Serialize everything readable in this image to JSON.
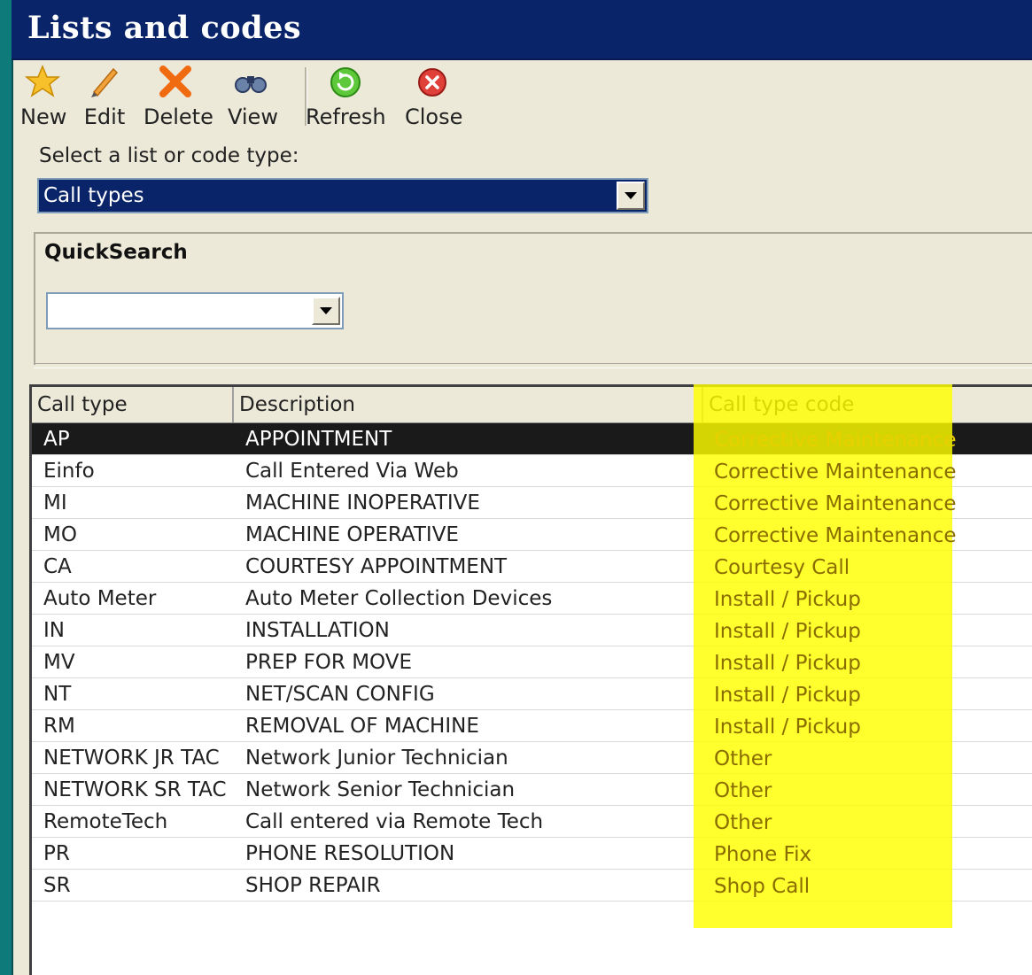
{
  "window": {
    "title": "Lists and codes"
  },
  "toolbar": {
    "new_label": "New",
    "edit_label": "Edit",
    "delete_label": "Delete",
    "view_label": "View",
    "refresh_label": "Refresh",
    "close_label": "Close"
  },
  "selector": {
    "label": "Select a list or code type:",
    "value": "Call types"
  },
  "quicksearch": {
    "title": "QuickSearch",
    "value": ""
  },
  "grid": {
    "columns": [
      "Call type",
      "Description",
      "Call type code"
    ],
    "rows": [
      {
        "type": "AP",
        "description": "APPOINTMENT",
        "code": "Corrective Maintenance",
        "selected": true
      },
      {
        "type": "Einfo",
        "description": "Call Entered Via Web",
        "code": "Corrective Maintenance"
      },
      {
        "type": "MI",
        "description": "MACHINE INOPERATIVE",
        "code": "Corrective Maintenance"
      },
      {
        "type": "MO",
        "description": "MACHINE OPERATIVE",
        "code": "Corrective Maintenance"
      },
      {
        "type": "CA",
        "description": "COURTESY APPOINTMENT",
        "code": "Courtesy Call"
      },
      {
        "type": "Auto Meter",
        "description": "Auto Meter Collection Devices",
        "code": "Install / Pickup"
      },
      {
        "type": "IN",
        "description": "INSTALLATION",
        "code": "Install / Pickup"
      },
      {
        "type": "MV",
        "description": "PREP FOR MOVE",
        "code": "Install / Pickup"
      },
      {
        "type": "NT",
        "description": "NET/SCAN CONFIG",
        "code": "Install / Pickup"
      },
      {
        "type": "RM",
        "description": "REMOVAL OF MACHINE",
        "code": "Install / Pickup"
      },
      {
        "type": "NETWORK JR TAC",
        "description": "Network Junior Technician",
        "code": "Other"
      },
      {
        "type": "NETWORK SR TAC",
        "description": "Network Senior Technician",
        "code": "Other"
      },
      {
        "type": "RemoteTech",
        "description": "Call entered via Remote Tech",
        "code": "Other"
      },
      {
        "type": "PR",
        "description": "PHONE RESOLUTION",
        "code": "Phone Fix"
      },
      {
        "type": "SR",
        "description": "SHOP REPAIR",
        "code": "Shop Call"
      }
    ]
  },
  "colors": {
    "title_bar": "#0a246a",
    "highlight": "#ffff00",
    "selected_row": "#1a1a1a",
    "code_text": "#8a6d00",
    "selected_code_text": "#e8d000"
  }
}
